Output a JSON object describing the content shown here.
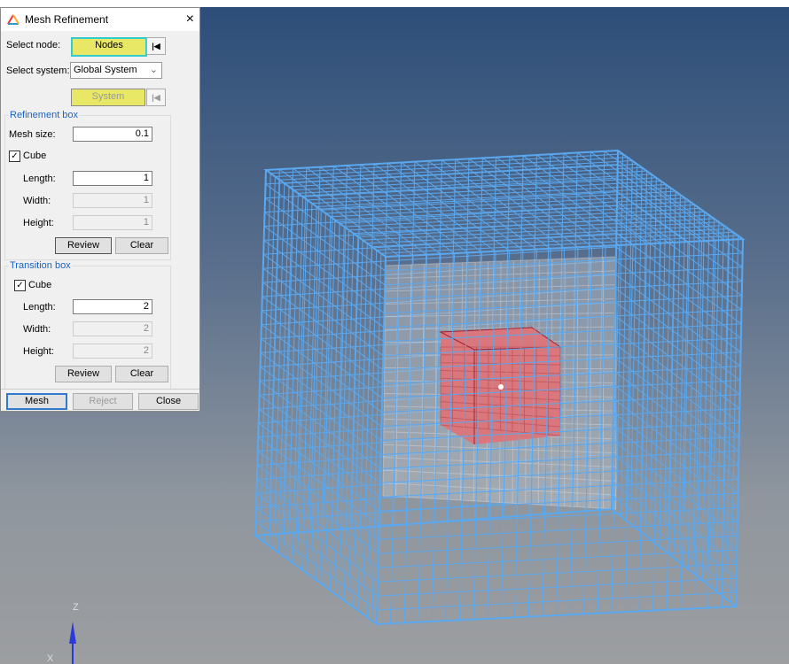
{
  "dialog": {
    "title": "Mesh Refinement",
    "close": "×",
    "select_node_label": "Select node:",
    "nodes_button": "Nodes",
    "select_system_label": "Select system:",
    "system_value": "Global System",
    "system_button": "System",
    "refinement": {
      "title": "Refinement box",
      "mesh_size_label": "Mesh size:",
      "mesh_size": "0.1",
      "cube_label": "Cube",
      "cube_checked": true,
      "length_label": "Length:",
      "length": "1",
      "width_label": "Width:",
      "width": "1",
      "height_label": "Height:",
      "height": "1",
      "review": "Review",
      "clear": "Clear"
    },
    "transition": {
      "title": "Transition box",
      "cube_label": "Cube",
      "cube_checked": true,
      "length_label": "Length:",
      "length": "2",
      "width_label": "Width:",
      "width": "2",
      "height_label": "Height:",
      "height": "2",
      "review": "Review",
      "clear": "Clear"
    },
    "mesh": "Mesh",
    "reject": "Reject",
    "close_button": "Close"
  },
  "viewport": {
    "axis_z": "Z",
    "axis_x": "X",
    "mesh_color": "#5aa8f0",
    "refine_color": "#d9777c"
  }
}
